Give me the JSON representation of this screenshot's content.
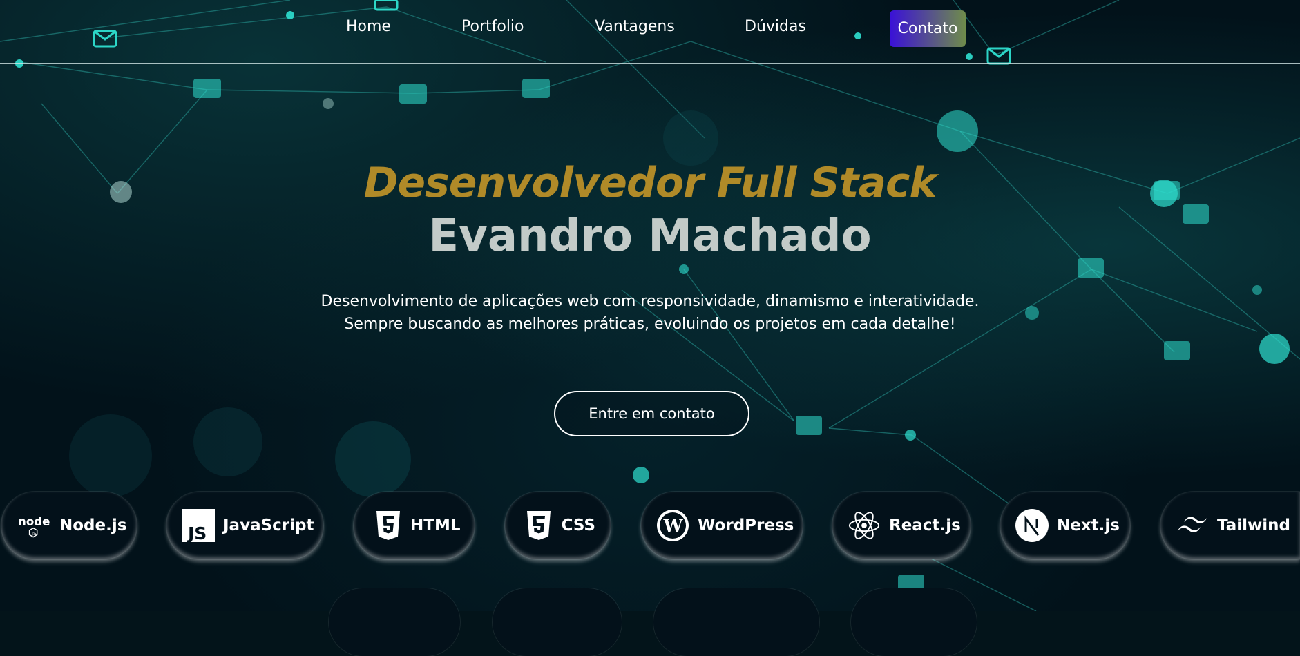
{
  "nav": {
    "items": [
      {
        "label": "Home"
      },
      {
        "label": "Portfolio"
      },
      {
        "label": "Vantagens"
      },
      {
        "label": "Dúvidas"
      }
    ],
    "contact_label": "Contato",
    "contact_gradient": [
      "#3a10d8",
      "#6f8c4a"
    ]
  },
  "hero": {
    "subtitle": "Desenvolvedor Full Stack",
    "name": "Evandro Machado",
    "description_line1": "Desenvolvimento de aplicações web com responsividade, dinamismo e interatividade.",
    "description_line2": "Sempre buscando as melhores práticas, evoluindo os projetos em cada detalhe!",
    "cta_label": "Entre em contato",
    "subtitle_color": "#b08a28"
  },
  "tech": [
    {
      "label": "Node.js",
      "icon": "nodejs-icon"
    },
    {
      "label": "JavaScript",
      "icon": "javascript-icon"
    },
    {
      "label": "HTML",
      "icon": "html5-icon"
    },
    {
      "label": "CSS",
      "icon": "css3-icon"
    },
    {
      "label": "WordPress",
      "icon": "wordpress-icon"
    },
    {
      "label": "React.js",
      "icon": "react-icon"
    },
    {
      "label": "Next.js",
      "icon": "nextjs-icon"
    },
    {
      "label": "Tailwind",
      "icon": "tailwind-icon"
    }
  ],
  "colors": {
    "background": "#02121a",
    "accent_network": "#2fd6c8"
  }
}
